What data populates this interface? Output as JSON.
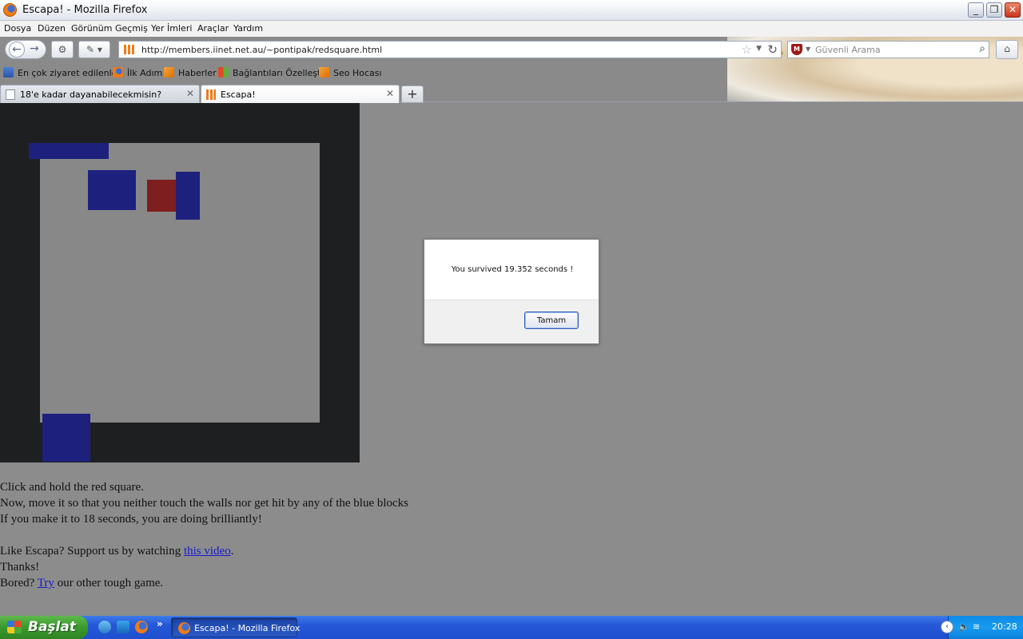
{
  "window": {
    "title": "Escapa! - Mozilla Firefox"
  },
  "menu": [
    "Dosya",
    "Düzen",
    "Görünüm",
    "Geçmiş",
    "Yer İmleri",
    "Araçlar",
    "Yardım"
  ],
  "navbar": {
    "url": "http://members.iinet.net.au/~pontipak/redsquare.html",
    "search_placeholder": "Güvenli Arama"
  },
  "bookmarks": [
    {
      "label": "En çok ziyaret edilenler",
      "icon": "smart-folder-icon"
    },
    {
      "label": "İlk Adım",
      "icon": "firefox-icon"
    },
    {
      "label": "Haberler",
      "icon": "rss-icon"
    },
    {
      "label": "Bağlantıları Özelleştir",
      "icon": "windows-icon"
    },
    {
      "label": "Seo Hocası",
      "icon": "rss-icon"
    }
  ],
  "tabs": [
    {
      "label": "18'e kadar dayanabilecekmisin?",
      "active": false
    },
    {
      "label": "Escapa!",
      "active": true
    }
  ],
  "page": {
    "line1": "Click and hold the red square.",
    "line2": "Now, move it so that you neither touch the walls nor get hit by any of the blue blocks",
    "line3": "If you make it to 18 seconds, you are doing brilliantly!",
    "support_prefix": "Like Escapa? Support us by watching ",
    "support_link": "this video",
    "support_suffix": ".",
    "thanks": "Thanks!",
    "bored_prefix": "Bored? ",
    "bored_link": "Try",
    "bored_suffix": " our other tough game."
  },
  "dialog": {
    "message": "You survived 19.352 seconds !",
    "ok_label": "Tamam"
  },
  "taskbar": {
    "start_label": "Başlat",
    "task_label": "Escapa! - Mozilla Firefox",
    "clock": "20:28"
  },
  "colors": {
    "wall": "#1e1f21",
    "arena": "#888888",
    "blue_block": "#1d217d",
    "red_square": "#7e1e1e"
  }
}
